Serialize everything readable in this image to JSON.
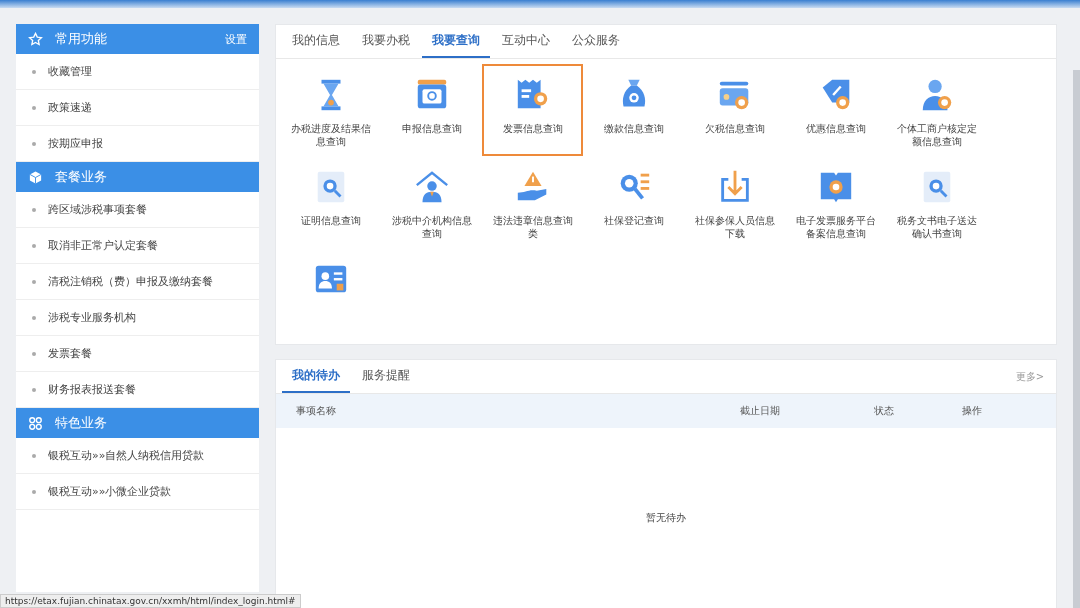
{
  "sidebar": {
    "sections": [
      {
        "title": "常用功能",
        "kind": "star",
        "action": "设置",
        "items": [
          "收藏管理",
          "政策速递",
          "按期应申报"
        ]
      },
      {
        "title": "套餐业务",
        "kind": "cube",
        "items": [
          "跨区域涉税事项套餐",
          "取消非正常户认定套餐",
          "清税注销税（费）申报及缴纳套餐",
          "涉税专业服务机构",
          "发票套餐",
          "财务报表报送套餐"
        ]
      },
      {
        "title": "特色业务",
        "kind": "grid",
        "items": [
          "银税互动»»自然人纳税信用贷款",
          "银税互动»»小微企业贷款"
        ]
      }
    ]
  },
  "main_tabs": [
    {
      "label": "我的信息",
      "selected": false
    },
    {
      "label": "我要办税",
      "selected": false
    },
    {
      "label": "我要查询",
      "selected": true
    },
    {
      "label": "互动中心",
      "selected": false
    },
    {
      "label": "公众服务",
      "selected": false
    }
  ],
  "services": [
    {
      "kind": "hourglass",
      "label": "办税进度及结果信息查询",
      "selected": false
    },
    {
      "kind": "monitor",
      "label": "申报信息查询",
      "selected": false
    },
    {
      "kind": "receipt",
      "label": "发票信息查询",
      "selected": true
    },
    {
      "kind": "bag",
      "label": "缴款信息查询",
      "selected": false
    },
    {
      "kind": "card",
      "label": "欠税信息查询",
      "selected": false
    },
    {
      "kind": "tag",
      "label": "优惠信息查询",
      "selected": false
    },
    {
      "kind": "person",
      "label": "个体工商户核定定额信息查询",
      "selected": false
    },
    {
      "kind": "doc",
      "label": "证明信息查询",
      "selected": false
    },
    {
      "kind": "house",
      "label": "涉税中介机构信息查询",
      "selected": false
    },
    {
      "kind": "warning",
      "label": "违法违章信息查询类",
      "selected": false
    },
    {
      "kind": "list",
      "label": "社保登记查询",
      "selected": false
    },
    {
      "kind": "download",
      "label": "社保参保人员信息下载",
      "selected": false
    },
    {
      "kind": "book",
      "label": "电子发票服务平台备案信息查询",
      "selected": false
    },
    {
      "kind": "doc",
      "label": "税务文书电子送达确认书查询",
      "selected": false
    },
    {
      "kind": "idcard",
      "selected": false
    }
  ],
  "todo": {
    "tabs": [
      {
        "label": "我的待办",
        "selected": true
      },
      {
        "label": "服务提醒",
        "selected": false
      }
    ],
    "more": "更多>",
    "columns": [
      "事项名称",
      "截止日期",
      "状态",
      "操作"
    ],
    "empty": "暂无待办"
  },
  "status_bar": {
    "url": "https://etax.fujian.chinatax.gov.cn/xxmh/html/index_login.html#"
  }
}
